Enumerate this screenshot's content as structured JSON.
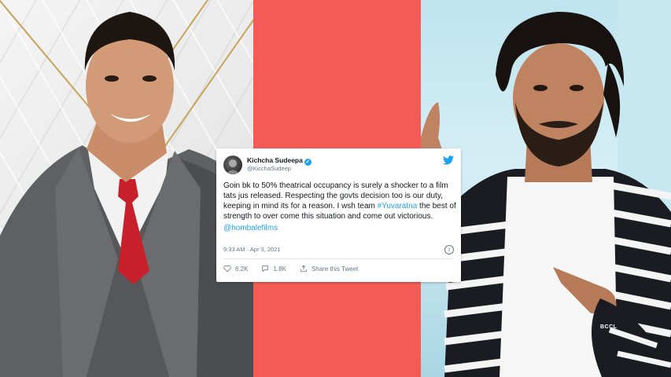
{
  "tweet": {
    "display_name": "Kichcha Sudeepa",
    "handle": "@KicchaSudeep",
    "text_before_tag": "Goin bk to 50% theatrical occupancy is surely a shocker to a film tats jus released. Respecting the govts decision too is our duty, keeping in mind its for a reason. I wsh team ",
    "hashtag": "#Yuvaratna",
    "text_after_tag": " the best of strength to over come this situation and come out victorious.",
    "mention": "@hombalefilms",
    "timestamp": "9:33 AM · Apr 3, 2021",
    "likes": "6.2K",
    "replies": "1.8K",
    "share_label": "Share this Tweet"
  },
  "watermark": "BCCL",
  "colors": {
    "band": "#f45b56",
    "twitter_blue": "#1da1f2",
    "muted_text": "#657786"
  }
}
